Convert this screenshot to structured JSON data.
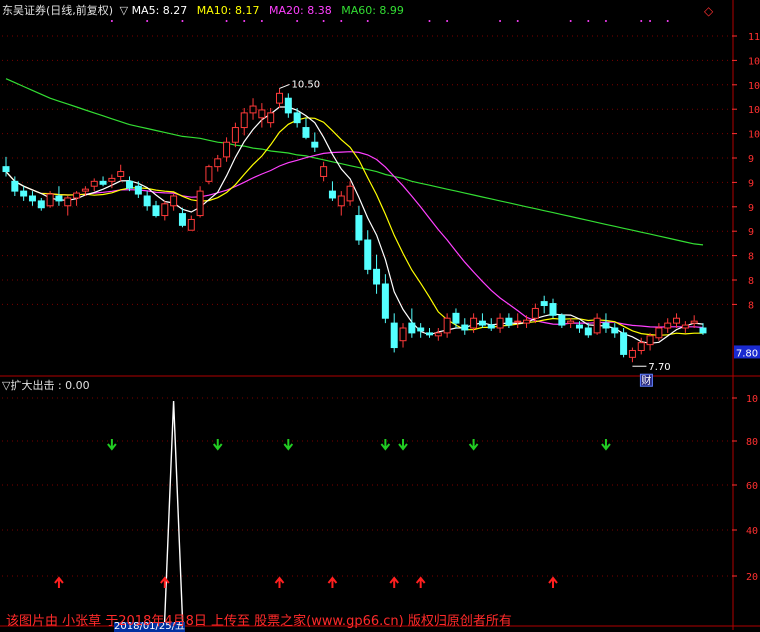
{
  "header": {
    "title": "东吴证券(日线,前复权)",
    "ma_marker": "▽",
    "ma5_label": "MA5: 8.27",
    "ma10_label": "MA10: 8.17",
    "ma20_label": "MA20: 8.38",
    "ma60_label": "MA60: 8.99",
    "corner_icon": "diamond-icon"
  },
  "indicator": {
    "label": "▽扩大出击 : 0.00"
  },
  "annotations": {
    "high": "10.50",
    "low": "7.70",
    "last_price": "7.80",
    "badge": "财"
  },
  "watermark": "该图片由 小张草 于2018年4月8日 上传至 股票之家(www.gp66.cn) 版权归原创者所有",
  "footer": {
    "date_label": "2018/01/25/五"
  },
  "colors": {
    "up": "#ff3a3a",
    "down": "#54ffff",
    "ma5": "#ffffff",
    "ma10": "#ffff00",
    "ma20": "#ff40ff",
    "ma60": "#33dd33",
    "grid": "#7a0000",
    "axis_text": "#ff3030",
    "buy_arrow": "#ff2020",
    "sell_arrow": "#22cc22"
  },
  "chart_data": [
    {
      "type": "candlestick",
      "title": "东吴证券(日线,前复权)",
      "y_ticks": [
        "11",
        "10",
        "10",
        "10",
        "10",
        "9",
        "9",
        "9",
        "9",
        "8",
        "8",
        "8"
      ],
      "ylim": [
        7.6,
        11.2
      ],
      "candles": [
        [
          9.7,
          9.8,
          9.6,
          9.65
        ],
        [
          9.55,
          9.6,
          9.4,
          9.45
        ],
        [
          9.45,
          9.5,
          9.35,
          9.4
        ],
        [
          9.4,
          9.45,
          9.3,
          9.35
        ],
        [
          9.35,
          9.38,
          9.25,
          9.28
        ],
        [
          9.3,
          9.45,
          9.28,
          9.42
        ],
        [
          9.4,
          9.5,
          9.3,
          9.35
        ],
        [
          9.3,
          9.4,
          9.2,
          9.38
        ],
        [
          9.38,
          9.45,
          9.3,
          9.43
        ],
        [
          9.45,
          9.5,
          9.4,
          9.47
        ],
        [
          9.5,
          9.58,
          9.45,
          9.55
        ],
        [
          9.55,
          9.6,
          9.5,
          9.52
        ],
        [
          9.55,
          9.62,
          9.48,
          9.58
        ],
        [
          9.6,
          9.72,
          9.55,
          9.65
        ],
        [
          9.55,
          9.6,
          9.45,
          9.48
        ],
        [
          9.5,
          9.55,
          9.38,
          9.42
        ],
        [
          9.4,
          9.45,
          9.25,
          9.3
        ],
        [
          9.3,
          9.35,
          9.18,
          9.2
        ],
        [
          9.2,
          9.35,
          9.15,
          9.32
        ],
        [
          9.3,
          9.42,
          9.25,
          9.4
        ],
        [
          9.22,
          9.28,
          9.08,
          9.1
        ],
        [
          9.05,
          9.2,
          9.05,
          9.16
        ],
        [
          9.2,
          9.5,
          9.18,
          9.45
        ],
        [
          9.55,
          9.72,
          9.52,
          9.7
        ],
        [
          9.7,
          9.82,
          9.65,
          9.78
        ],
        [
          9.8,
          10.0,
          9.75,
          9.95
        ],
        [
          9.95,
          10.15,
          9.9,
          10.1
        ],
        [
          10.1,
          10.3,
          10.02,
          10.25
        ],
        [
          10.25,
          10.4,
          10.18,
          10.32
        ],
        [
          10.2,
          10.35,
          10.1,
          10.28
        ],
        [
          10.15,
          10.3,
          10.1,
          10.25
        ],
        [
          10.35,
          10.5,
          10.3,
          10.45
        ],
        [
          10.4,
          10.45,
          10.2,
          10.25
        ],
        [
          10.25,
          10.3,
          10.1,
          10.15
        ],
        [
          10.1,
          10.2,
          9.98,
          10.0
        ],
        [
          9.95,
          10.05,
          9.85,
          9.9
        ],
        [
          9.6,
          9.75,
          9.55,
          9.7
        ],
        [
          9.45,
          9.55,
          9.35,
          9.38
        ],
        [
          9.3,
          9.45,
          9.2,
          9.4
        ],
        [
          9.35,
          9.55,
          9.3,
          9.5
        ],
        [
          9.2,
          9.3,
          8.9,
          8.95
        ],
        [
          8.95,
          9.05,
          8.6,
          8.65
        ],
        [
          8.65,
          8.8,
          8.4,
          8.5
        ],
        [
          8.5,
          8.6,
          8.1,
          8.15
        ],
        [
          8.1,
          8.2,
          7.8,
          7.85
        ],
        [
          7.92,
          8.1,
          7.85,
          8.05
        ],
        [
          8.1,
          8.25,
          7.95,
          8.0
        ],
        [
          8.05,
          8.1,
          7.95,
          8.02
        ],
        [
          8.0,
          8.05,
          7.95,
          7.98
        ],
        [
          7.97,
          8.05,
          7.92,
          8.0
        ],
        [
          8.0,
          8.2,
          7.95,
          8.15
        ],
        [
          8.2,
          8.25,
          8.05,
          8.1
        ],
        [
          8.08,
          8.15,
          7.98,
          8.03
        ],
        [
          8.05,
          8.2,
          8.0,
          8.15
        ],
        [
          8.12,
          8.2,
          8.05,
          8.08
        ],
        [
          8.08,
          8.15,
          8.02,
          8.05
        ],
        [
          8.05,
          8.2,
          8.0,
          8.15
        ],
        [
          8.15,
          8.2,
          8.05,
          8.08
        ],
        [
          8.12,
          8.2,
          8.05,
          8.12
        ],
        [
          8.1,
          8.18,
          8.05,
          8.13
        ],
        [
          8.15,
          8.3,
          8.1,
          8.25
        ],
        [
          8.32,
          8.38,
          8.2,
          8.28
        ],
        [
          8.3,
          8.35,
          8.15,
          8.18
        ],
        [
          8.18,
          8.2,
          8.05,
          8.08
        ],
        [
          8.1,
          8.15,
          8.05,
          8.12
        ],
        [
          8.08,
          8.12,
          8.0,
          8.05
        ],
        [
          8.05,
          8.1,
          7.95,
          7.98
        ],
        [
          8.0,
          8.2,
          7.98,
          8.15
        ],
        [
          8.1,
          8.2,
          8.0,
          8.05
        ],
        [
          8.05,
          8.1,
          7.95,
          8.0
        ],
        [
          8.0,
          8.05,
          7.75,
          7.78
        ],
        [
          7.75,
          7.85,
          7.7,
          7.82
        ],
        [
          7.82,
          7.95,
          7.78,
          7.9
        ],
        [
          7.88,
          8.0,
          7.82,
          7.97
        ],
        [
          7.95,
          8.1,
          7.92,
          8.05
        ],
        [
          8.05,
          8.15,
          8.0,
          8.1
        ],
        [
          8.1,
          8.2,
          8.05,
          8.15
        ],
        [
          8.05,
          8.12,
          8.0,
          8.08
        ],
        [
          8.1,
          8.18,
          8.05,
          8.12
        ],
        [
          8.05,
          8.1,
          7.98,
          8.0
        ]
      ],
      "ma60": [
        10.6,
        10.56,
        10.52,
        10.48,
        10.44,
        10.4,
        10.37,
        10.34,
        10.31,
        10.28,
        10.25,
        10.22,
        10.19,
        10.16,
        10.13,
        10.11,
        10.09,
        10.07,
        10.05,
        10.03,
        10.01,
        10.0,
        9.99,
        9.97,
        9.95,
        9.94,
        9.92,
        9.91,
        9.89,
        9.88,
        9.86,
        9.85,
        9.84,
        9.82,
        9.81,
        9.79,
        9.77,
        9.75,
        9.73,
        9.71,
        9.69,
        9.67,
        9.65,
        9.62,
        9.6,
        9.58,
        9.55,
        9.53,
        9.51,
        9.49,
        9.47,
        9.45,
        9.43,
        9.41,
        9.39,
        9.37,
        9.35,
        9.33,
        9.31,
        9.29,
        9.27,
        9.25,
        9.23,
        9.21,
        9.19,
        9.17,
        9.15,
        9.13,
        9.11,
        9.09,
        9.07,
        9.05,
        9.03,
        9.01,
        8.99,
        8.97,
        8.95,
        8.93,
        8.91,
        8.9
      ]
    },
    {
      "type": "line",
      "title": "扩大出击",
      "y_ticks": [
        "10",
        "80",
        "60",
        "40",
        "20"
      ],
      "ylim": [
        0,
        105
      ],
      "spike_index": 19,
      "spike_value": 100,
      "sell_arrow_indices": [
        12,
        24,
        32,
        43,
        45,
        53,
        68
      ],
      "buy_arrow_indices": [
        6,
        18,
        31,
        37,
        44,
        47,
        62
      ]
    }
  ]
}
